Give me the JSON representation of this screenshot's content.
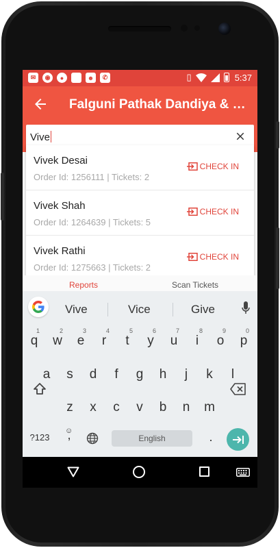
{
  "status_bar": {
    "time": "5:37"
  },
  "app_bar": {
    "title": "Falguni Pathak Dandiya & Ra...",
    "back_icon": "arrow-back-icon"
  },
  "search": {
    "value": "Vive",
    "clear_icon": "close-icon"
  },
  "results": [
    {
      "name": "Vivek Desai",
      "meta": "Order Id: 1256111 | Tickets: 2",
      "action": "CHECK IN"
    },
    {
      "name": "Vivek Shah",
      "meta": "Order Id: 1264639 | Tickets: 5",
      "action": "CHECK IN"
    },
    {
      "name": "Vivek Rathi",
      "meta": "Order Id: 1275663 | Tickets: 2",
      "action": "CHECK IN"
    }
  ],
  "tabs": {
    "reports": "Reports",
    "scan": "Scan Tickets"
  },
  "keyboard": {
    "suggestions": [
      "Vive",
      "Vice",
      "Give"
    ],
    "row1": [
      "q",
      "w",
      "e",
      "r",
      "t",
      "y",
      "u",
      "i",
      "o",
      "p"
    ],
    "row1_hints": [
      "1",
      "2",
      "3",
      "4",
      "5",
      "6",
      "7",
      "8",
      "9",
      "0"
    ],
    "row2": [
      "a",
      "s",
      "d",
      "f",
      "g",
      "h",
      "j",
      "k",
      "l"
    ],
    "row3": [
      "z",
      "x",
      "c",
      "v",
      "b",
      "n",
      "m"
    ],
    "symbols_label": "?123",
    "comma": ",",
    "space_label": "English",
    "period": "."
  },
  "colors": {
    "accent": "#ef5541",
    "status": "#e0443a",
    "enter": "#4db6ac"
  }
}
